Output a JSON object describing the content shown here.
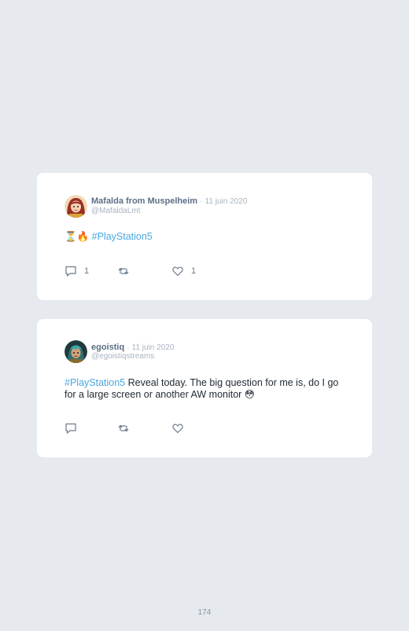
{
  "page": {
    "number": "174"
  },
  "tweets": [
    {
      "author": {
        "name": "Mafalda from Muspelheim",
        "handle": "@MafaldaLmt"
      },
      "separator": "·",
      "date": "11 juin 2020",
      "body": {
        "emoji": "⏳🔥",
        "hashtag": "#PlayStation5",
        "text": ""
      },
      "stats": {
        "replies": "1",
        "retweets": "",
        "likes": "1"
      }
    },
    {
      "author": {
        "name": "egoistiq",
        "handle": "@egoistiqstreams"
      },
      "separator": "·",
      "date": "11 juin 2020",
      "body": {
        "emoji": "",
        "hashtag": "#PlayStation5",
        "text": " Reveal today. The big question for me is, do I go for a large screen or another AW monitor 😳"
      },
      "stats": {
        "replies": "",
        "retweets": "",
        "likes": ""
      }
    }
  ],
  "icons": {
    "reply": "speech-bubble-icon",
    "retweet": "retweet-arrows-icon",
    "like": "heart-outline-icon"
  },
  "colors": {
    "page_background": "#e6e9ed",
    "card_background": "#ffffff",
    "hashtag": "#4aa8df",
    "author_name": "#5d6f86",
    "muted": "#a8b4c2",
    "icon": "#6b7a8c"
  }
}
